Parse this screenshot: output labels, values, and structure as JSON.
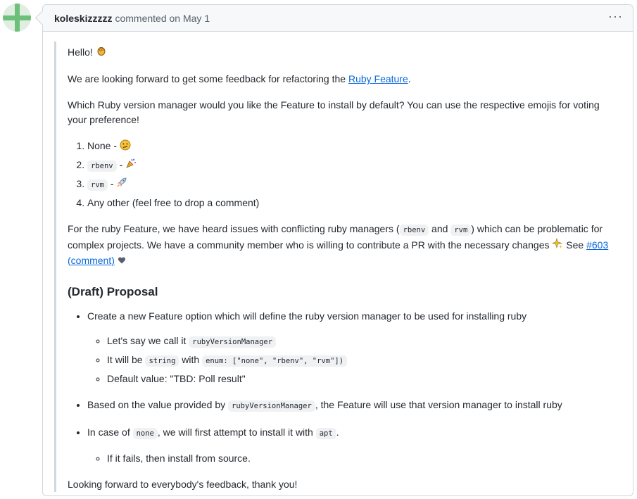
{
  "comment": {
    "author": "koleskizzzzz",
    "meta": "commented on May 1",
    "greeting": "Hello!",
    "p1_before": "We are looking forward to get some feedback for refactoring the ",
    "p1_link": "Ruby Feature",
    "p1_after": ".",
    "p2": "Which Ruby version manager would you like the Feature to install by default? You can use the respective emojis for voting your preference!",
    "options": [
      {
        "label": "None",
        "code": "",
        "sep": " - "
      },
      {
        "label": "",
        "code": "rbenv",
        "sep": " - "
      },
      {
        "label": "",
        "code": "rvm",
        "sep": " - "
      },
      {
        "label": "Any other (feel free to drop a comment)",
        "code": "",
        "sep": ""
      }
    ],
    "p3_a": "For the ruby Feature, we have heard issues with conflicting ruby managers (",
    "p3_code1": "rbenv",
    "p3_and": " and ",
    "p3_code2": "rvm",
    "p3_b": ") which can be problematic for complex projects. We have a community member who is willing to contribute a PR with the necessary changes",
    "p3_see": " See ",
    "p3_link1": "#603",
    "p3_link2": "(comment)",
    "heading": "(Draft) Proposal",
    "b1": "Create a new Feature option which will define the ruby version manager to be used for installing ruby",
    "b1_s1_text": "Let's say we call it ",
    "b1_s1_code": "rubyVersionManager",
    "b1_s2_text1": "It will be ",
    "b1_s2_code1": "string",
    "b1_s2_text2": " with ",
    "b1_s2_code2": "enum: [\"none\", \"rbenv\", \"rvm\"])",
    "b1_s3": "Default value: \"TBD: Poll result\"",
    "b2_text1": "Based on the value provided by ",
    "b2_code": "rubyVersionManager",
    "b2_text2": ", the Feature will use that version manager to install ruby",
    "b3_text1": "In case of ",
    "b3_code1": "none",
    "b3_text2": ", we will first attempt to install it with ",
    "b3_code2": "apt",
    "b3_text3": ".",
    "b3_s1": "If it fails, then install from source.",
    "closing": "Looking forward to everybody's feedback, thank you!"
  },
  "icons": [
    "waving-hand-icon",
    "confused-face-icon",
    "party-popper-icon",
    "rocket-icon",
    "sparkles-icon",
    "heart-icon",
    "kebab-menu-icon"
  ]
}
